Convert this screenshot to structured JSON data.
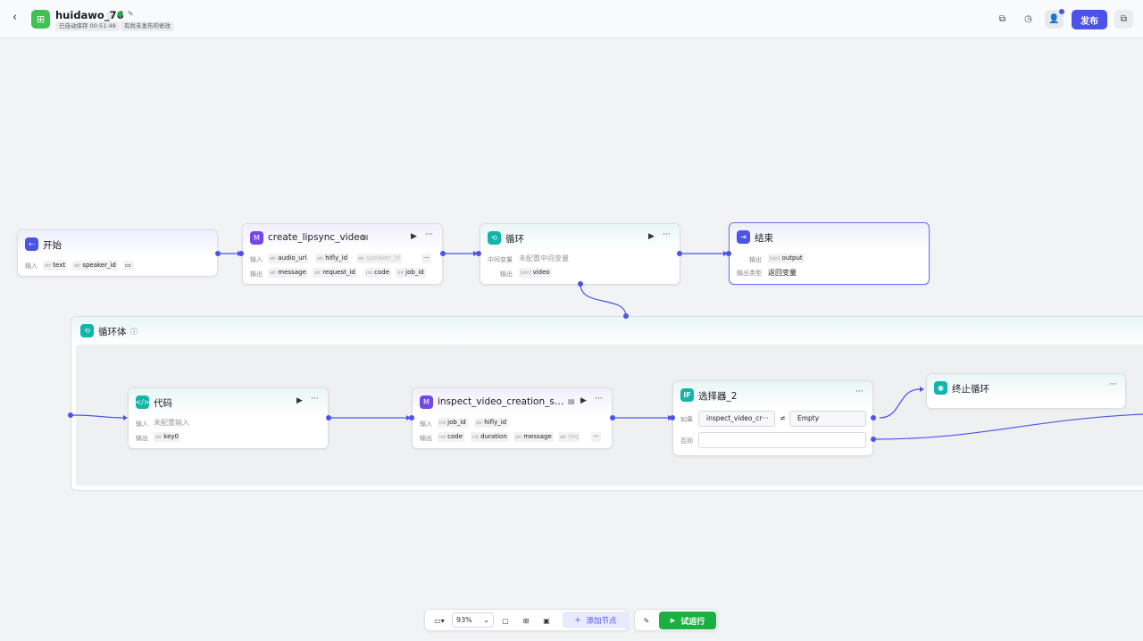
{
  "header": {
    "app_name": "huidawo_76",
    "autosave": "已自动保存 00:51:49",
    "unpublished": "有尚未发布的修改",
    "publish_label": "发布"
  },
  "nodes": {
    "start": {
      "title": "开始",
      "input_label": "输入",
      "inputs": [
        {
          "type": "str",
          "name": "text"
        },
        {
          "type": "str",
          "name": "speaker_id"
        }
      ]
    },
    "lipsync": {
      "title": "create_lipsync_video",
      "input_label": "输入",
      "output_label": "输出",
      "inputs": [
        {
          "type": "str",
          "name": "audio_url"
        },
        {
          "type": "str",
          "name": "hifly_id"
        },
        {
          "type": "str",
          "name": "speaker_id"
        }
      ],
      "outputs": [
        {
          "type": "str",
          "name": "message"
        },
        {
          "type": "str",
          "name": "request_id"
        },
        {
          "type": "int",
          "name": "code"
        },
        {
          "type": "int",
          "name": "job_id"
        }
      ]
    },
    "loop": {
      "title": "循环",
      "mid_label": "中间变量",
      "mid_placeholder": "未配置中间变量",
      "output_label": "输出",
      "output": {
        "type": "[str]",
        "name": "video"
      }
    },
    "end": {
      "title": "结束",
      "output_label": "输出",
      "output": {
        "type": "[str]",
        "name": "output"
      },
      "output_type_label": "输出类型",
      "output_type_value": "返回变量"
    },
    "loopbody": {
      "title": "循环体"
    },
    "code": {
      "title": "代码",
      "input_label": "输入",
      "input_placeholder": "未配置输入",
      "output_label": "输出",
      "output": {
        "type": "str",
        "name": "key0"
      }
    },
    "inspect": {
      "title": "inspect_video_creation_sta···",
      "input_label": "输入",
      "output_label": "输出",
      "inputs": [
        {
          "type": "int",
          "name": "job_id"
        },
        {
          "type": "str",
          "name": "hifly_id"
        }
      ],
      "outputs": [
        {
          "type": "int",
          "name": "code"
        },
        {
          "type": "int",
          "name": "duration"
        },
        {
          "type": "str",
          "name": "message"
        },
        {
          "type": "str",
          "name": "req"
        }
      ]
    },
    "selector": {
      "title": "选择器_2",
      "if_label": "如果",
      "else_label": "否则",
      "cond_left": "inspect_video_cr···",
      "cond_op": "≠",
      "cond_right": "Empty"
    },
    "stoploop": {
      "title": "终止循环"
    }
  },
  "bottom": {
    "zoom": "93%",
    "add_node": "添加节点",
    "test_run": "试运行"
  },
  "colors": {
    "accent": "#4d53e8",
    "run": "#1bb140",
    "loop": "#13b4aa",
    "plugin": "#7447e8"
  }
}
